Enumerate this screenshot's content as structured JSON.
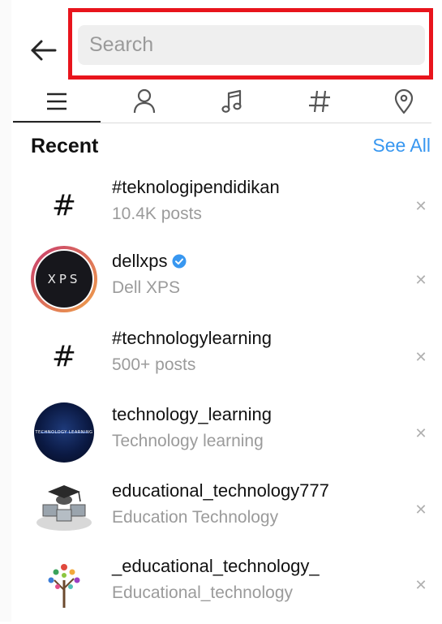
{
  "header": {
    "search_placeholder": "Search"
  },
  "tabs": [
    {
      "name": "Top",
      "icon": "list-icon",
      "active": true
    },
    {
      "name": "Accounts",
      "icon": "person-icon",
      "active": false
    },
    {
      "name": "Audio",
      "icon": "music-note-icon",
      "active": false
    },
    {
      "name": "Tags",
      "icon": "hashtag-icon",
      "active": false
    },
    {
      "name": "Places",
      "icon": "location-pin-icon",
      "active": false
    }
  ],
  "recent": {
    "title": "Recent",
    "see_all": "See All",
    "items": [
      {
        "type": "hashtag",
        "title": "#teknologipendidikan",
        "subtitle": "10.4K posts",
        "avatar_text": "#"
      },
      {
        "type": "account",
        "title": "dellxps",
        "subtitle": "Dell XPS",
        "verified": true,
        "avatar_text": "XPS"
      },
      {
        "type": "hashtag",
        "title": "#technologylearning",
        "subtitle": "500+ posts",
        "avatar_text": "#"
      },
      {
        "type": "account",
        "title": "technology_learning",
        "subtitle": "Technology learning",
        "avatar_text": "TECHNOLOGY LEARNING"
      },
      {
        "type": "account",
        "title": "educational_technology777",
        "subtitle": "Education Technology"
      },
      {
        "type": "account",
        "title": "_educational_technology_",
        "subtitle": "Educational_technology"
      }
    ]
  },
  "colors": {
    "accent": "#3897f0",
    "highlight_border": "#e8141c",
    "verified_badge": "#3897f0"
  }
}
